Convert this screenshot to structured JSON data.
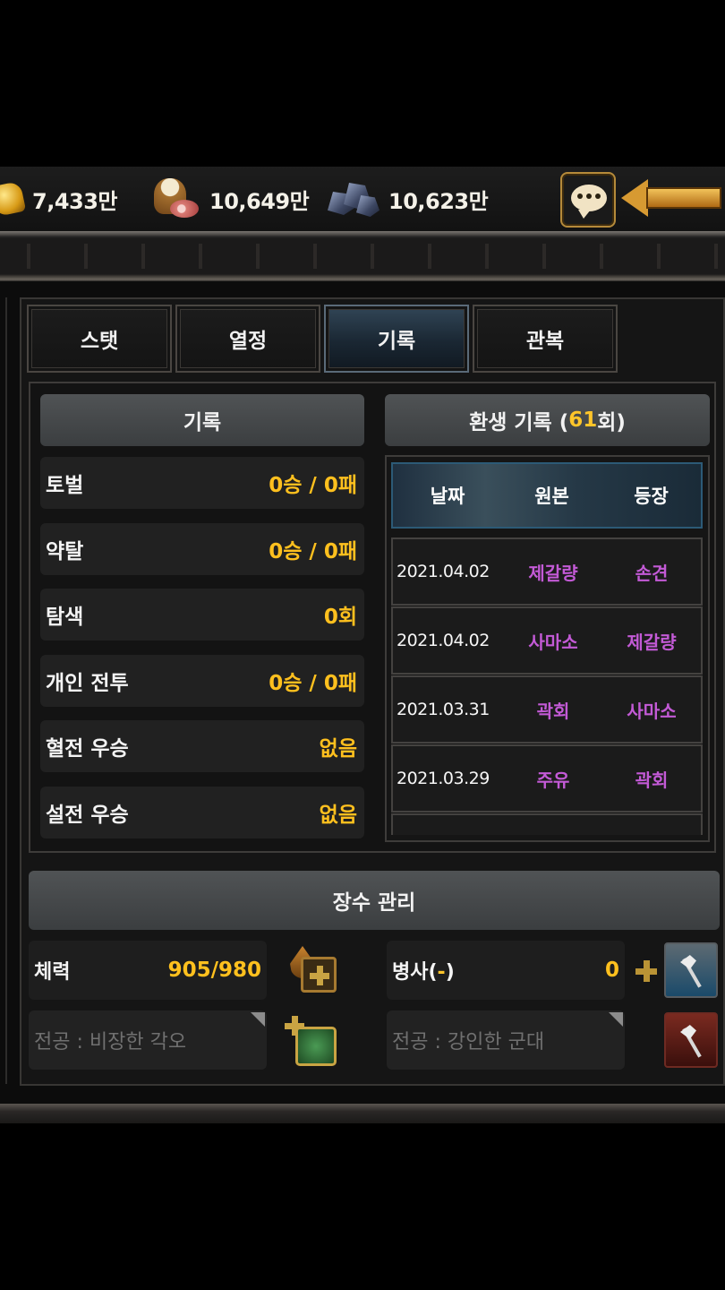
{
  "resources": {
    "gold": "7,433만",
    "food": "10,649만",
    "iron": "10,623만"
  },
  "tabs": [
    {
      "label": "스탯",
      "active": false
    },
    {
      "label": "열정",
      "active": false
    },
    {
      "label": "기록",
      "active": true
    },
    {
      "label": "관복",
      "active": false
    }
  ],
  "records": {
    "title": "기록",
    "items": [
      {
        "label": "토벌",
        "value": "0승 / 0패"
      },
      {
        "label": "약탈",
        "value": "0승 / 0패"
      },
      {
        "label": "탐색",
        "value": "0회"
      },
      {
        "label": "개인 전투",
        "value": "0승 / 0패"
      },
      {
        "label": "혈전 우승",
        "value": "없음"
      },
      {
        "label": "설전 우승",
        "value": "없음"
      }
    ]
  },
  "rebirth": {
    "title_prefix": "환생 기록 (",
    "count": "61",
    "title_suffix": "회)",
    "columns": [
      "날짜",
      "원본",
      "등장"
    ],
    "rows": [
      {
        "date": "2021.04.02",
        "original": "제갈량",
        "appeared": "손견"
      },
      {
        "date": "2021.04.02",
        "original": "사마소",
        "appeared": "제갈량"
      },
      {
        "date": "2021.03.31",
        "original": "곽회",
        "appeared": "사마소"
      },
      {
        "date": "2021.03.29",
        "original": "주유",
        "appeared": "곽회"
      }
    ]
  },
  "management": {
    "title": "장수 관리",
    "hp_label": "체력",
    "hp_value": "905/980",
    "troop_label_prefix": "병사(",
    "troop_label_highlight": "-",
    "troop_label_suffix": ")",
    "troop_value": "0",
    "skill_left": "전공 : 비장한 각오",
    "skill_right": "전공 : 강인한 군대"
  },
  "colors": {
    "accent_gold": "#ffc01e",
    "general_name": "#c35ad6",
    "active_tab": "#1a2733"
  },
  "icons": [
    "gold-icon",
    "food-icon",
    "iron-icon",
    "chat-icon",
    "arrow-left-icon",
    "potion-plus-icon",
    "skill-plus-icon",
    "axe-icon",
    "axe-red-icon",
    "plus-icon"
  ]
}
